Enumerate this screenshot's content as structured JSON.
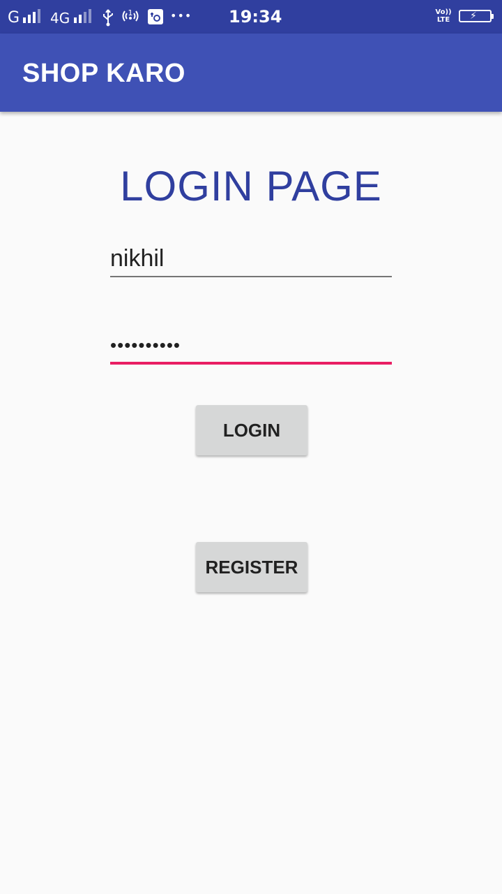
{
  "status_bar": {
    "sim1_label": "G",
    "sim2_label": "4G",
    "time": "19:34",
    "volte_top": "Vo))",
    "volte_bottom": "LTE",
    "more": "•••",
    "icons": [
      "signal-icon",
      "signal-icon",
      "usb-icon",
      "hotspot-icon",
      "sim-toolkit-icon",
      "more-icon",
      "volte-icon",
      "battery-charging-icon"
    ]
  },
  "app_bar": {
    "title": "SHOP KARO",
    "color": "#3f51b5"
  },
  "main": {
    "heading": "LOGIN PAGE",
    "username_value": "nikhil",
    "password_value": "••••••••••",
    "login_label": "LOGIN",
    "register_label": "REGISTER"
  },
  "colors": {
    "status_bar": "#303f9f",
    "accent": "#e91e63",
    "heading": "#303f9f",
    "button": "#d6d7d7"
  }
}
